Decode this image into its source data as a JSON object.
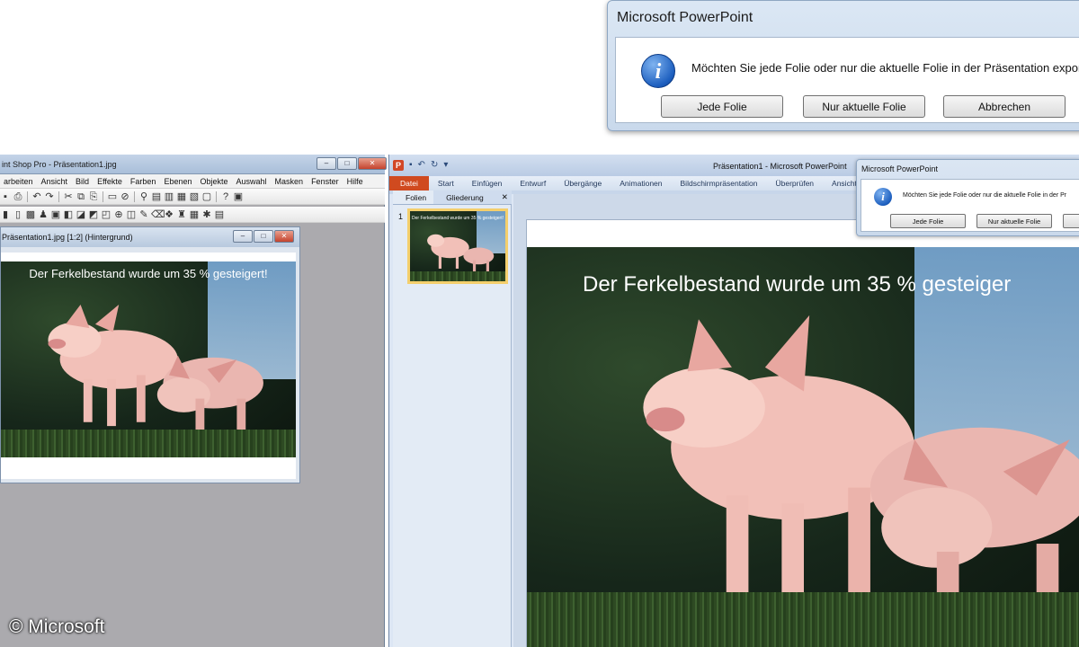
{
  "big_dialog": {
    "title": "Microsoft PowerPoint",
    "message": "Möchten Sie jede Folie oder nur die aktuelle Folie in der Präsentation exportier",
    "buttons": [
      "Jede Folie",
      "Nur aktuelle Folie",
      "Abbrechen"
    ]
  },
  "psp": {
    "title": "int Shop Pro - Präsentation1.jpg",
    "menu": [
      "arbeiten",
      "Ansicht",
      "Bild",
      "Effekte",
      "Farben",
      "Ebenen",
      "Objekte",
      "Auswahl",
      "Masken",
      "Fenster",
      "Hilfe"
    ],
    "window_buttons": [
      "–",
      "□",
      "✕"
    ],
    "doc_title": "Präsentation1.jpg [1:2] (Hintergrund)",
    "slide_text": "Der Ferkelbestand wurde um 35 % gesteigert!"
  },
  "ppt": {
    "title": "Präsentation1 - Microsoft PowerPoint",
    "logo": "P",
    "tabs": [
      "Datei",
      "Start",
      "Einfügen",
      "Entwurf",
      "Übergänge",
      "Animationen",
      "Bildschirmpräsentation",
      "Überprüfen",
      "Ansicht"
    ],
    "panel_tabs": [
      "Folien",
      "Gliederung"
    ],
    "panel_close": "✕",
    "slide_number": "1",
    "thumb_text": "Der Ferkelbestand wurde um 35 % gesteigert!",
    "slide_text": "Der Ferkelbestand wurde um 35 % gesteiger"
  },
  "small_dialog": {
    "title": "Microsoft PowerPoint",
    "message": "Möchten Sie jede Folie oder nur die aktuelle Folie in der Pr",
    "buttons": [
      "Jede Folie",
      "Nur aktuelle Folie",
      ""
    ]
  },
  "copyright": "© Microsoft",
  "icons": {
    "info": "i",
    "psp_toolbar1": [
      "folder-open-icon",
      "save-icon",
      "print-icon",
      "undo-icon",
      "redo-icon",
      "cut-icon",
      "copy-icon",
      "paste-icon",
      "monitor-icon",
      "stop-icon",
      "zoom-icon",
      "image-icon",
      "histogram-icon",
      "layers-icon",
      "window-icon",
      "help-icon",
      "lock-icon"
    ],
    "psp_toolbar2": [
      "tool-icon"
    ]
  }
}
